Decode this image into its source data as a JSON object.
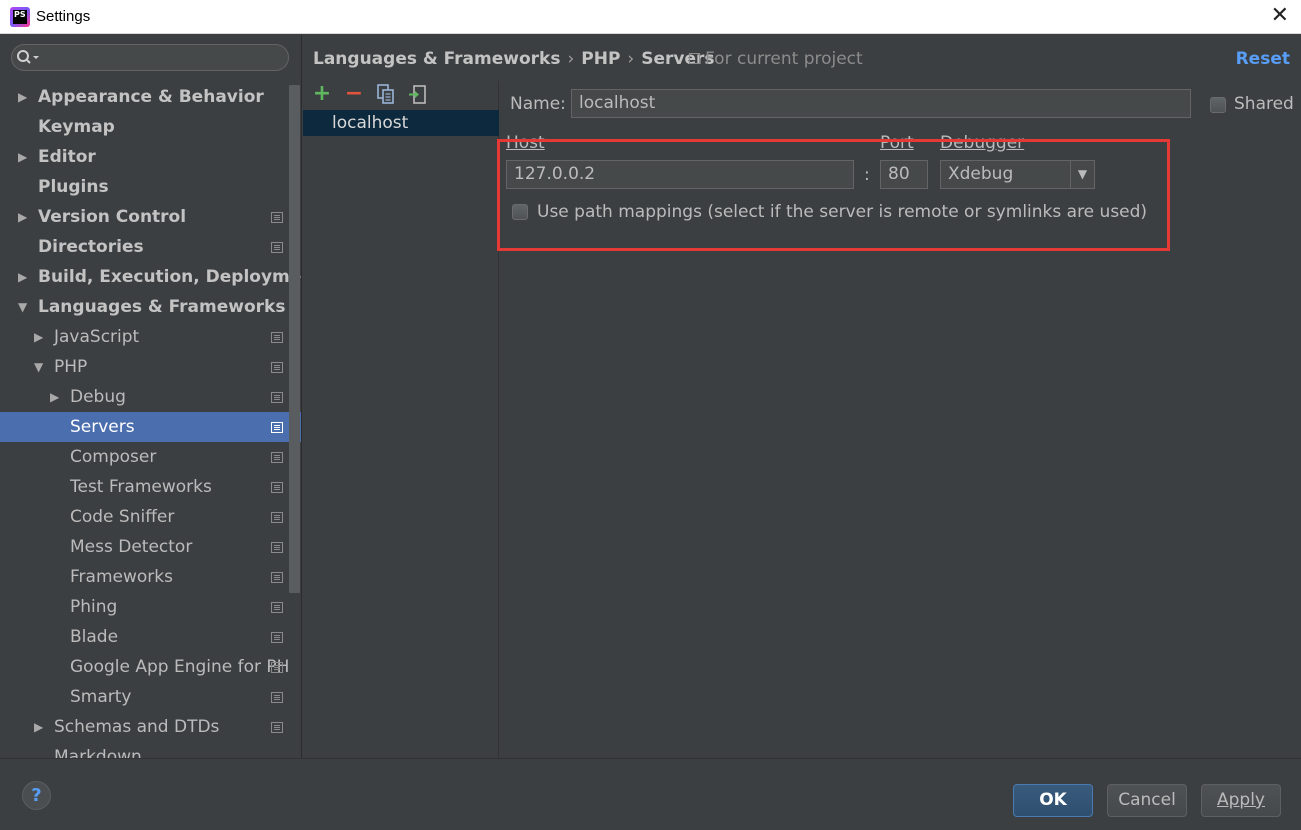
{
  "window": {
    "title": "Settings",
    "close_glyph": "✕",
    "logo_text": "PS"
  },
  "search": {
    "placeholder": "",
    "icon": "search-icon"
  },
  "tree": [
    {
      "label": "Appearance & Behavior",
      "bold": true,
      "level": 0,
      "arrow": "▶",
      "proj": false
    },
    {
      "label": "Keymap",
      "bold": true,
      "level": 0,
      "arrow": "",
      "proj": false
    },
    {
      "label": "Editor",
      "bold": true,
      "level": 0,
      "arrow": "▶",
      "proj": false
    },
    {
      "label": "Plugins",
      "bold": true,
      "level": 0,
      "arrow": "",
      "proj": false
    },
    {
      "label": "Version Control",
      "bold": true,
      "level": 0,
      "arrow": "▶",
      "proj": true
    },
    {
      "label": "Directories",
      "bold": true,
      "level": 0,
      "arrow": "",
      "proj": true
    },
    {
      "label": "Build, Execution, Deployment",
      "bold": true,
      "level": 0,
      "arrow": "▶",
      "proj": false
    },
    {
      "label": "Languages & Frameworks",
      "bold": true,
      "level": 0,
      "arrow": "▼",
      "proj": false
    },
    {
      "label": "JavaScript",
      "bold": false,
      "level": 1,
      "arrow": "▶",
      "proj": true
    },
    {
      "label": "PHP",
      "bold": false,
      "level": 1,
      "arrow": "▼",
      "proj": true
    },
    {
      "label": "Debug",
      "bold": false,
      "level": 2,
      "arrow": "▶",
      "proj": true
    },
    {
      "label": "Servers",
      "bold": false,
      "level": 2,
      "arrow": "",
      "proj": true,
      "selected": true
    },
    {
      "label": "Composer",
      "bold": false,
      "level": 2,
      "arrow": "",
      "proj": true
    },
    {
      "label": "Test Frameworks",
      "bold": false,
      "level": 2,
      "arrow": "",
      "proj": true
    },
    {
      "label": "Code Sniffer",
      "bold": false,
      "level": 2,
      "arrow": "",
      "proj": true
    },
    {
      "label": "Mess Detector",
      "bold": false,
      "level": 2,
      "arrow": "",
      "proj": true
    },
    {
      "label": "Frameworks",
      "bold": false,
      "level": 2,
      "arrow": "",
      "proj": true
    },
    {
      "label": "Phing",
      "bold": false,
      "level": 2,
      "arrow": "",
      "proj": true
    },
    {
      "label": "Blade",
      "bold": false,
      "level": 2,
      "arrow": "",
      "proj": true
    },
    {
      "label": "Google App Engine for PH",
      "bold": false,
      "level": 2,
      "arrow": "",
      "proj": true
    },
    {
      "label": "Smarty",
      "bold": false,
      "level": 2,
      "arrow": "",
      "proj": true
    },
    {
      "label": "Schemas and DTDs",
      "bold": false,
      "level": 1,
      "arrow": "▶",
      "proj": true
    },
    {
      "label": "Markdown",
      "bold": false,
      "level": 1,
      "arrow": "",
      "proj": false
    }
  ],
  "breadcrumb": {
    "items": [
      "Languages & Frameworks",
      "PHP",
      "Servers"
    ],
    "separator": "›"
  },
  "scope": {
    "label": "For current project"
  },
  "reset_label": "Reset",
  "server_list": {
    "add_glyph": "+",
    "remove_glyph": "−",
    "servers": [
      "localhost"
    ]
  },
  "form": {
    "name_label": "Name:",
    "name_value": "localhost",
    "shared_label": "Shared",
    "host_label": "Host",
    "host_value": "127.0.0.2",
    "colon": ":",
    "port_label": "Port",
    "port_value": "80",
    "debugger_label": "Debugger",
    "debugger_value": "Xdebug",
    "dropdown_glyph": "▼",
    "path_mappings_label": "Use path mappings (select if the server is remote or symlinks are used)"
  },
  "buttons": {
    "help": "?",
    "ok": "OK",
    "cancel": "Cancel",
    "apply": "Apply"
  },
  "colors": {
    "background": "#3c3f41",
    "selection": "#4b6eaf",
    "link": "#589df6",
    "highlight_border": "#e53935"
  }
}
